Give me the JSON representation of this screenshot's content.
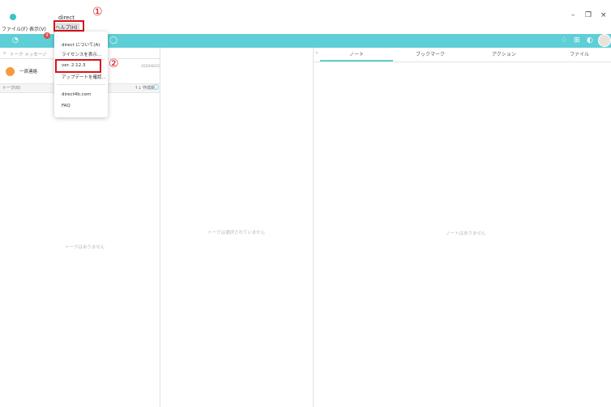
{
  "window": {
    "title": "direct",
    "minimize_glyph": "–",
    "restore_glyph": "❐",
    "close_glyph": "×"
  },
  "menubar": {
    "file": "ファイル(F)",
    "view": "表示(V)",
    "help": "ヘルプ(H)"
  },
  "topbar": {
    "badge_count": "9",
    "icons": [
      "app-logo-icon",
      "chat-icon",
      "bell-icon",
      "grid-icon",
      "settings-icon",
      "user-avatar"
    ]
  },
  "help_menu": {
    "items": [
      "direct について(A)",
      "ライセンスを表示...",
      "ver. 2.12.3",
      "アップデートを確認...",
      "direct4b.com",
      "FAQ"
    ]
  },
  "left_pane": {
    "search_placeholder": "トーク  メッセージ",
    "group_name": "一斉連絡",
    "group_date": "2020/8/22",
    "talk_list_label": "トーク(0)",
    "sort_label": "↑↓ 作成順",
    "empty_message": "トークはありません"
  },
  "middle_pane": {
    "empty_message": "トークは選択されていません"
  },
  "right_pane": {
    "tabs": [
      "ノート",
      "ブックマーク",
      "アクション",
      "ファイル"
    ],
    "empty_message": "ノートはありません"
  },
  "annotations": {
    "step1": "①",
    "step2": "②",
    "color": "#d6141a"
  },
  "colors": {
    "accent": "#5ecfd6",
    "badge": "#e0484d",
    "group_avatar": "#f79a3e"
  }
}
